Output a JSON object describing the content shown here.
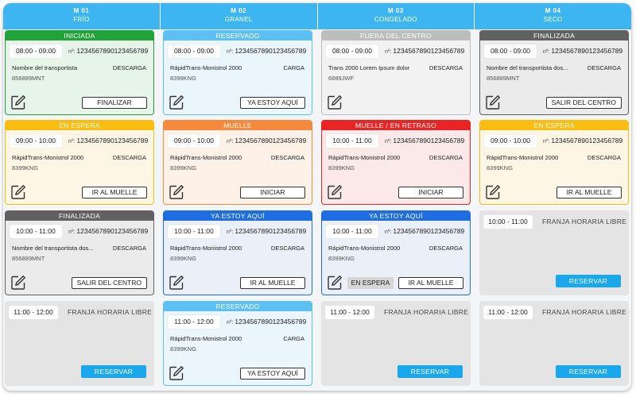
{
  "docks": [
    {
      "code": "M 01",
      "type": "FRÍO"
    },
    {
      "code": "M 02",
      "type": "GRANEL"
    },
    {
      "code": "M 03",
      "type": "CONGELADO"
    },
    {
      "code": "M 04",
      "type": "SECO"
    }
  ],
  "ref_prefix": "nº:",
  "icon_names": {
    "edit": "edit-icon"
  },
  "colors": {
    "header_blue": "#3db5f0",
    "iniciada": "#21a33a",
    "reservado": "#5cc0f5",
    "fuera": "#bdbdbd",
    "finalizada": "#616161",
    "en_espera": "#fbbd12",
    "muelle": "#f5893e",
    "retraso": "#e82424",
    "ya_estoy": "#1e6de2",
    "reserve_button": "#1aa7ec"
  },
  "slots": [
    [
      {
        "status": "INICIADA",
        "time": "08:00 - 09:00",
        "ref": "1234567890123456789",
        "carrier": "Nombre del transportista",
        "operation": "DESCARGA",
        "plate": "856889MNT",
        "action": "FINALIZAR"
      },
      {
        "status": "EN ESPERA",
        "time": "09:00 - 10:00",
        "ref": "1234567890123456789",
        "carrier": "RápidTrans-Monistrol 2000",
        "operation": "DESCARGA",
        "plate": "8399KNG",
        "action": "IR AL MUELLE"
      },
      {
        "status": "FINALIZADA",
        "time": "10:00 - 11:00",
        "ref": "1234567890123456789",
        "carrier": "Nombre del transportista dos...",
        "operation": "DESCARGA",
        "plate": "856889MNT",
        "action": "SALIR DEL CENTRO"
      },
      {
        "free": true,
        "time": "11:00 - 12:00",
        "label": "FRANJA HORARIA LIBRE",
        "action": "RESERVAR"
      }
    ],
    [
      {
        "status": "RESERVADO",
        "time": "08:00 - 09:00",
        "ref": "1234567890123456789",
        "carrier": "RápidTrans-Monistrol 2000",
        "operation": "CARGA",
        "plate": "8399KNG",
        "action": "YA ESTOY AQUÍ"
      },
      {
        "status": "MUELLE",
        "time": "09:00 - 10:00",
        "ref": "1234567890123456789",
        "carrier": "RápidTrans-Monistrol 2000",
        "operation": "DESCARGA",
        "plate": "8399KNG",
        "action": "INICIAR"
      },
      {
        "status": "YA ESTOY AQUÍ",
        "time": "10:00 - 11:00",
        "ref": "1234567890123456789",
        "carrier": "RápidTrans-Monistrol 2000",
        "operation": "DESCARGA",
        "plate": "8399KNG",
        "action": "IR AL MUELLE"
      },
      {
        "status": "RESERVADO",
        "time": "11:00 - 12:00",
        "ref": "1234567890123456789",
        "carrier": "RápidTrans-Monistrol 2000",
        "operation": "CARGA",
        "plate": "8399KNG",
        "action": "YA ESTOY AQUÍ"
      }
    ],
    [
      {
        "status": "FUERA DEL CENTRO",
        "time": "08:00 - 09:00",
        "ref": "1234567890123456789",
        "carrier": "Trans 2000 Lorem Ipsum dolor",
        "operation": "DESCARGA",
        "plate": "6889JWF"
      },
      {
        "status": "MUELLE / EN RETRASO",
        "time": "10:00 - 11:00",
        "ref": "1234567890123456789",
        "carrier": "RápidTrans-Monistrol 2000",
        "operation": "DESCARGA",
        "plate": "8399KNG",
        "action": "INICIAR"
      },
      {
        "status": "YA ESTOY AQUÍ",
        "time": "10:00 - 11:00",
        "ref": "1234567890123456789",
        "carrier": "RápidTrans-Monistrol 2000",
        "operation": "DESCARGA",
        "plate": "8399KNG",
        "secondary_action": "EN ESPERA",
        "action": "IR AL MUELLE"
      },
      {
        "free": true,
        "time": "11:00 - 12:00",
        "label": "FRANJA HORARIA LIBRE",
        "action": "RESERVAR"
      }
    ],
    [
      {
        "status": "FINALIZADA",
        "time": "08:00 - 09:00",
        "ref": "1234567890123456789",
        "carrier": "Nombre del transportista dos...",
        "operation": "DESCARGA",
        "plate": "856889MNT",
        "action": "SALIR DEL CENTRO"
      },
      {
        "status": "EN ESPERA",
        "time": "09:00 - 10:00",
        "ref": "1234567890123456789",
        "carrier": "RápidTrans-Monistrol 2000",
        "operation": "DESCARGA",
        "plate": "8399KNG",
        "action": "IR AL MUELLE"
      },
      {
        "free": true,
        "time": "10:00 - 11:00",
        "label": "FRANJA HORARIA LIBRE",
        "action": "RESERVAR"
      },
      {
        "free": true,
        "time": "11:00 - 12:00",
        "label": "FRANJA HORARIA LIBRE",
        "action": "RESERVAR"
      }
    ]
  ]
}
